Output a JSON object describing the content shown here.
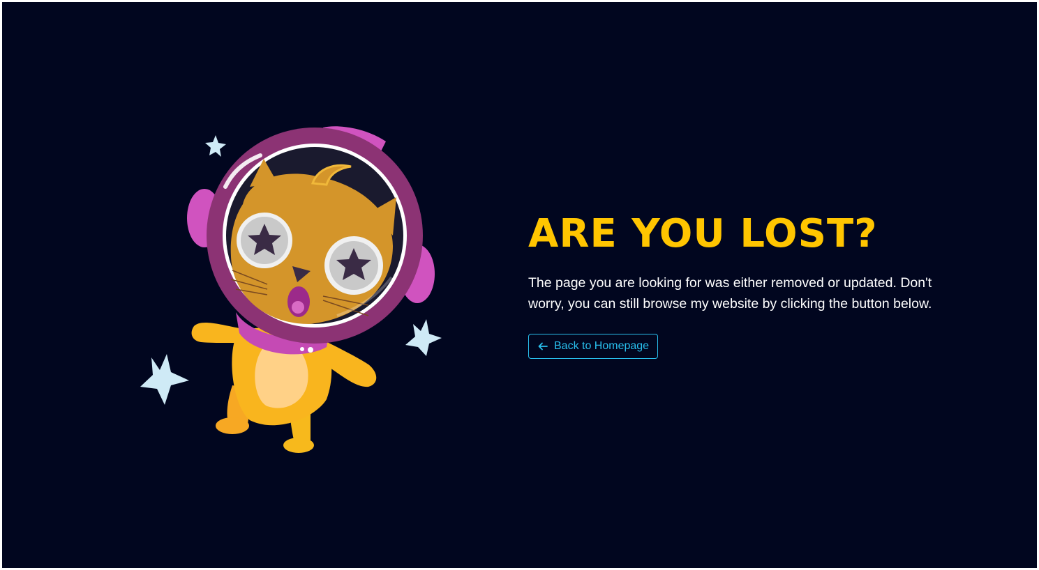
{
  "error_page": {
    "title": "ARE YOU LOST?",
    "message": "The page you are looking for was either removed or updated. Don't worry, you can still browse my website by clicking the button below.",
    "back_button_label": "Back to Homepage",
    "back_button_icon": "arrow-left-icon",
    "illustration": "astronaut-cat-illustration"
  },
  "colors": {
    "background": "#01061f",
    "title": "#ffc500",
    "text": "#ffffff",
    "accent": "#29c0ee"
  }
}
